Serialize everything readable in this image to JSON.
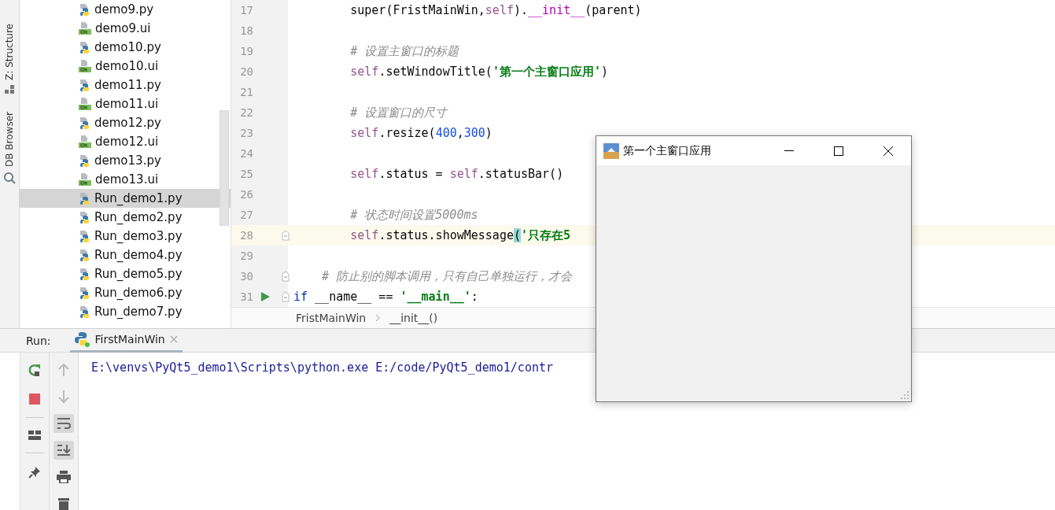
{
  "tool_stripe": {
    "items": [
      {
        "label": "Z: Structure",
        "kind": "structure"
      },
      {
        "label": "DB Browser",
        "kind": "db"
      }
    ]
  },
  "project_tree": {
    "items": [
      {
        "name": "demo9.py",
        "kind": "py",
        "selected": false
      },
      {
        "name": "demo9.ui",
        "kind": "ui",
        "selected": false
      },
      {
        "name": "demo10.py",
        "kind": "py",
        "selected": false
      },
      {
        "name": "demo10.ui",
        "kind": "ui",
        "selected": false
      },
      {
        "name": "demo11.py",
        "kind": "py",
        "selected": false
      },
      {
        "name": "demo11.ui",
        "kind": "ui",
        "selected": false
      },
      {
        "name": "demo12.py",
        "kind": "py",
        "selected": false
      },
      {
        "name": "demo12.ui",
        "kind": "ui",
        "selected": false
      },
      {
        "name": "demo13.py",
        "kind": "py",
        "selected": false
      },
      {
        "name": "demo13.ui",
        "kind": "ui",
        "selected": false
      },
      {
        "name": "Run_demo1.py",
        "kind": "py",
        "selected": true
      },
      {
        "name": "Run_demo2.py",
        "kind": "py",
        "selected": false
      },
      {
        "name": "Run_demo3.py",
        "kind": "py",
        "selected": false
      },
      {
        "name": "Run_demo4.py",
        "kind": "py",
        "selected": false
      },
      {
        "name": "Run_demo5.py",
        "kind": "py",
        "selected": false
      },
      {
        "name": "Run_demo6.py",
        "kind": "py",
        "selected": false
      },
      {
        "name": "Run_demo7.py",
        "kind": "py",
        "selected": false
      }
    ]
  },
  "editor": {
    "lines": [
      {
        "number": "17",
        "current": false,
        "fold": false,
        "runnable": false,
        "tokens": [
          {
            "kind": "plain",
            "text": "        super(FristMainWin,"
          },
          {
            "kind": "self",
            "text": "self"
          },
          {
            "kind": "plain",
            "text": ")."
          },
          {
            "kind": "dunder",
            "text": "__init__"
          },
          {
            "kind": "plain",
            "text": "(parent)"
          }
        ]
      },
      {
        "number": "18",
        "current": false,
        "fold": false,
        "runnable": false
      },
      {
        "number": "19",
        "current": false,
        "fold": false,
        "runnable": false,
        "tokens": [
          {
            "kind": "comment",
            "text": "        # 设置主窗口的标题"
          }
        ]
      },
      {
        "number": "20",
        "current": false,
        "fold": false,
        "runnable": false,
        "tokens": [
          {
            "kind": "self",
            "text": "        self"
          },
          {
            "kind": "plain",
            "text": ".setWindowTitle("
          },
          {
            "kind": "string",
            "text": "'第一个主窗口应用'"
          },
          {
            "kind": "plain",
            "text": ")"
          }
        ]
      },
      {
        "number": "21",
        "current": false,
        "fold": false,
        "runnable": false
      },
      {
        "number": "22",
        "current": false,
        "fold": false,
        "runnable": false,
        "tokens": [
          {
            "kind": "comment",
            "text": "        # 设置窗口的尺寸"
          }
        ]
      },
      {
        "number": "23",
        "current": false,
        "fold": false,
        "runnable": false,
        "tokens": [
          {
            "kind": "self",
            "text": "        self"
          },
          {
            "kind": "plain",
            "text": ".resize("
          },
          {
            "kind": "number",
            "text": "400"
          },
          {
            "kind": "plain",
            "text": ","
          },
          {
            "kind": "number",
            "text": "300"
          },
          {
            "kind": "plain",
            "text": ")"
          }
        ]
      },
      {
        "number": "24",
        "current": false,
        "fold": false,
        "runnable": false
      },
      {
        "number": "25",
        "current": false,
        "fold": false,
        "runnable": false,
        "tokens": [
          {
            "kind": "self",
            "text": "        self"
          },
          {
            "kind": "plain",
            "text": ".status = "
          },
          {
            "kind": "self",
            "text": "self"
          },
          {
            "kind": "plain",
            "text": ".statusBar()"
          }
        ]
      },
      {
        "number": "26",
        "current": false,
        "fold": false,
        "runnable": false
      },
      {
        "number": "27",
        "current": false,
        "fold": false,
        "runnable": false,
        "tokens": [
          {
            "kind": "comment",
            "text": "        # 状态时间设置5000ms"
          }
        ]
      },
      {
        "number": "28",
        "current": true,
        "fold": true,
        "runnable": false,
        "tokens": [
          {
            "kind": "self",
            "text": "        self"
          },
          {
            "kind": "plain",
            "text": ".status.showMessage"
          },
          {
            "kind": "brace",
            "text": "("
          },
          {
            "kind": "string",
            "text": "'只存在5"
          }
        ]
      },
      {
        "number": "29",
        "current": false,
        "fold": false,
        "runnable": false
      },
      {
        "number": "30",
        "current": false,
        "fold": true,
        "runnable": false,
        "tokens": [
          {
            "kind": "comment",
            "text": "    # 防止别的脚本调用，只有自己单独运行，才会"
          }
        ]
      },
      {
        "number": "31",
        "current": false,
        "fold": true,
        "runnable": true,
        "tokens": [
          {
            "kind": "keyword",
            "text": "if"
          },
          {
            "kind": "plain",
            "text": " __name__ == "
          },
          {
            "kind": "string",
            "text": "'__main__'"
          },
          {
            "kind": "plain",
            "text": ":"
          }
        ]
      }
    ],
    "breadcrumb": [
      "FristMainWin",
      "__init__()"
    ]
  },
  "run_panel": {
    "label": "Run:",
    "tabs": [
      {
        "label": "FirstMainWin",
        "selected": true
      }
    ],
    "console": [
      "E:\\venvs\\PyQt5_demo1\\Scripts\\python.exe E:/code/PyQt5_demo1/contr"
    ]
  },
  "app_window": {
    "title": "第一个主窗口应用"
  }
}
